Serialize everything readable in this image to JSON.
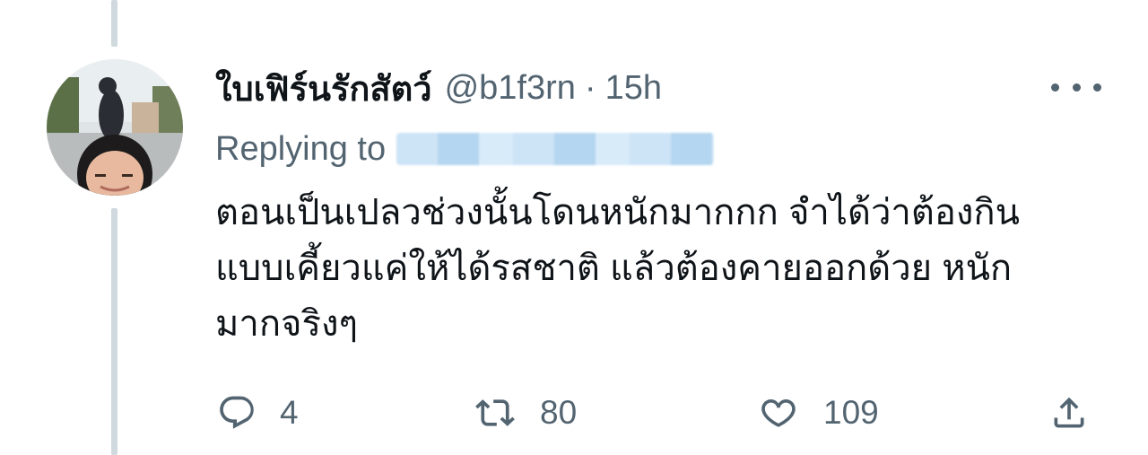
{
  "tweet": {
    "display_name": "ใบเฟิร์นรักสัตว์",
    "handle": "@b1f3rn",
    "separator": "·",
    "time": "15h",
    "replying_to_label": "Replying to",
    "text_lines": [
      "ตอนเป็นเปลวช่วงนั้นโดนหนักมากกก จำได้ว่าต้องกิน",
      "แบบเคี้ยวแค่ให้ได้รสชาติ แล้วต้องคายออกด้วย หนัก",
      "มากจริงๆ"
    ],
    "more_icon": "more-horizontal-icon"
  },
  "actions": {
    "reply": {
      "icon": "reply-icon",
      "count": "4"
    },
    "retweet": {
      "icon": "retweet-icon",
      "count": "80"
    },
    "like": {
      "icon": "heart-icon",
      "count": "109"
    },
    "share": {
      "icon": "share-icon"
    }
  },
  "colors": {
    "text": "#0f1419",
    "muted": "#536471",
    "thread_line": "#cfd9de"
  }
}
